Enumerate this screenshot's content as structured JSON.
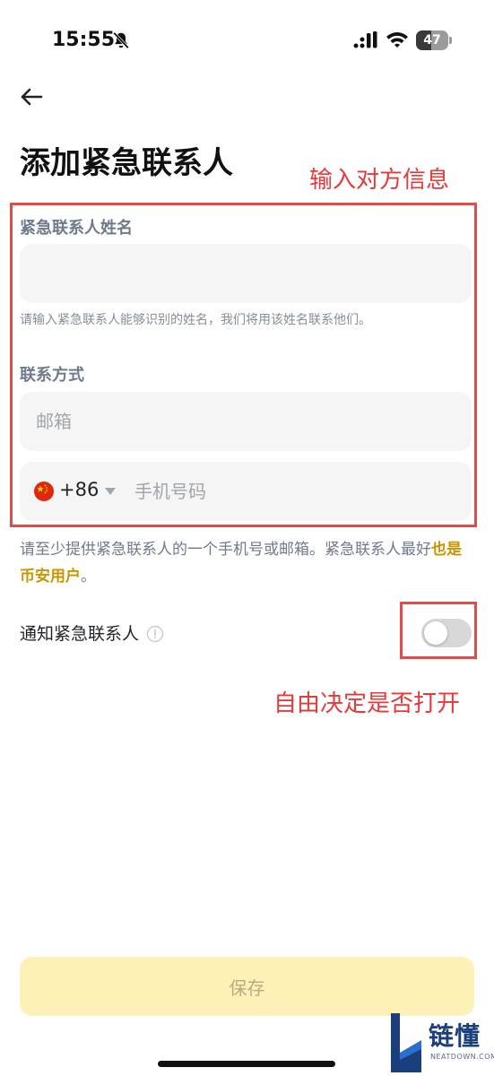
{
  "status_bar": {
    "time": "15:55",
    "battery_level": "47",
    "icons": [
      "bell-slash-icon",
      "signal-icon",
      "wifi-icon",
      "battery-icon"
    ]
  },
  "header": {
    "back_icon": "arrow-left-icon",
    "title": "添加紧急联系人"
  },
  "annotations": {
    "form_note": "输入对方信息",
    "toggle_note": "自由决定是否打开",
    "highlight_color": "#e8393a"
  },
  "form": {
    "name_label": "紧急联系人姓名",
    "name_value": "",
    "name_hint": "请输入紧急联系人能够识别的姓名，我们将用该姓名联系他们。",
    "contact_label": "联系方式",
    "email_placeholder": "邮箱",
    "email_value": "",
    "country_flag_icon": "china-flag-icon",
    "dial_code": "+86",
    "phone_placeholder": "手机号码",
    "phone_value": "",
    "note_text": "请至少提供紧急联系人的一个手机号或邮箱。紧急联系人最好",
    "note_link": "也是币安用户",
    "note_end": "。"
  },
  "notify": {
    "label": "通知紧急联系人",
    "enabled": false
  },
  "actions": {
    "save_label": "保存"
  },
  "watermark": {
    "cn": "链懂",
    "en": "NEATDOWN.COM"
  },
  "colors": {
    "accent_link": "#c99400",
    "save_bg": "#fdf1b8",
    "input_bg": "#f5f5f5"
  }
}
